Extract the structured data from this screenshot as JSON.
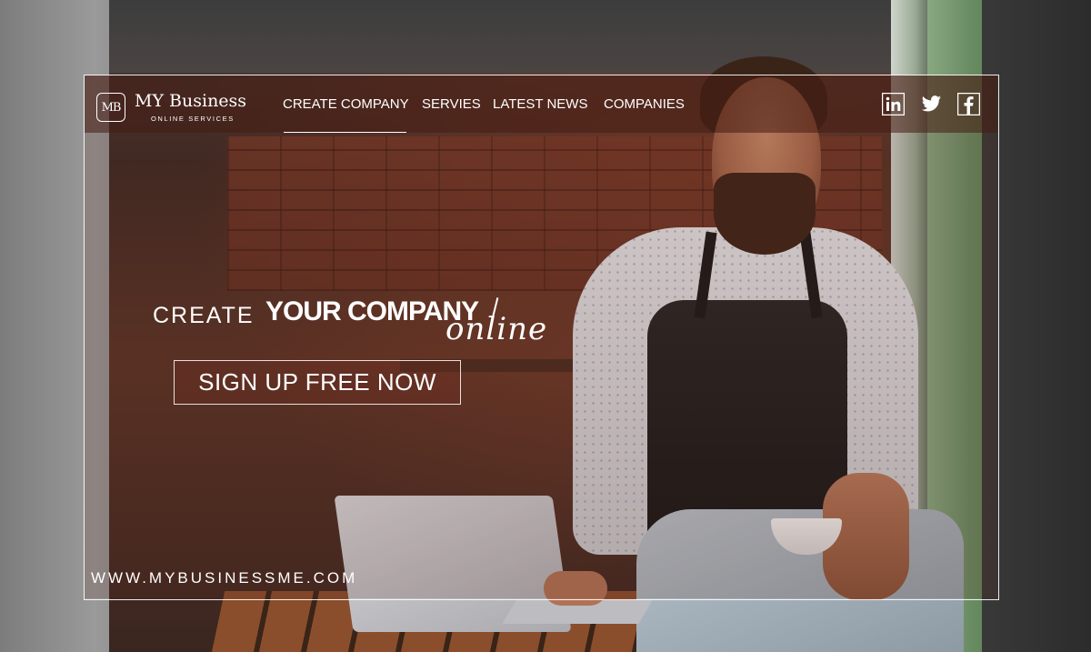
{
  "brand": {
    "logo_initials": "MB",
    "name": "MY Business",
    "tagline": "ONLINE SERVICES"
  },
  "nav": {
    "items": [
      {
        "label": "CREATE COMPANY",
        "active": true
      },
      {
        "label": "SERVIES",
        "active": false
      },
      {
        "label": "LATEST NEWS",
        "active": false
      },
      {
        "label": "COMPANIES",
        "active": false
      }
    ]
  },
  "social": [
    {
      "icon": "linkedin-icon"
    },
    {
      "icon": "twitter-icon"
    },
    {
      "icon": "facebook-icon"
    }
  ],
  "hero": {
    "line_prefix": "CREATE",
    "line_emphasis": "YOUR COMPANY",
    "line_script": "online",
    "cta_label": "SIGN UP FREE NOW"
  },
  "footer": {
    "website": "WWW.MYBUSINESSME.COM"
  },
  "colors": {
    "overlay_text": "#ffffff",
    "navbar_tint": "#461c12",
    "frame_border": "#ffffff"
  }
}
